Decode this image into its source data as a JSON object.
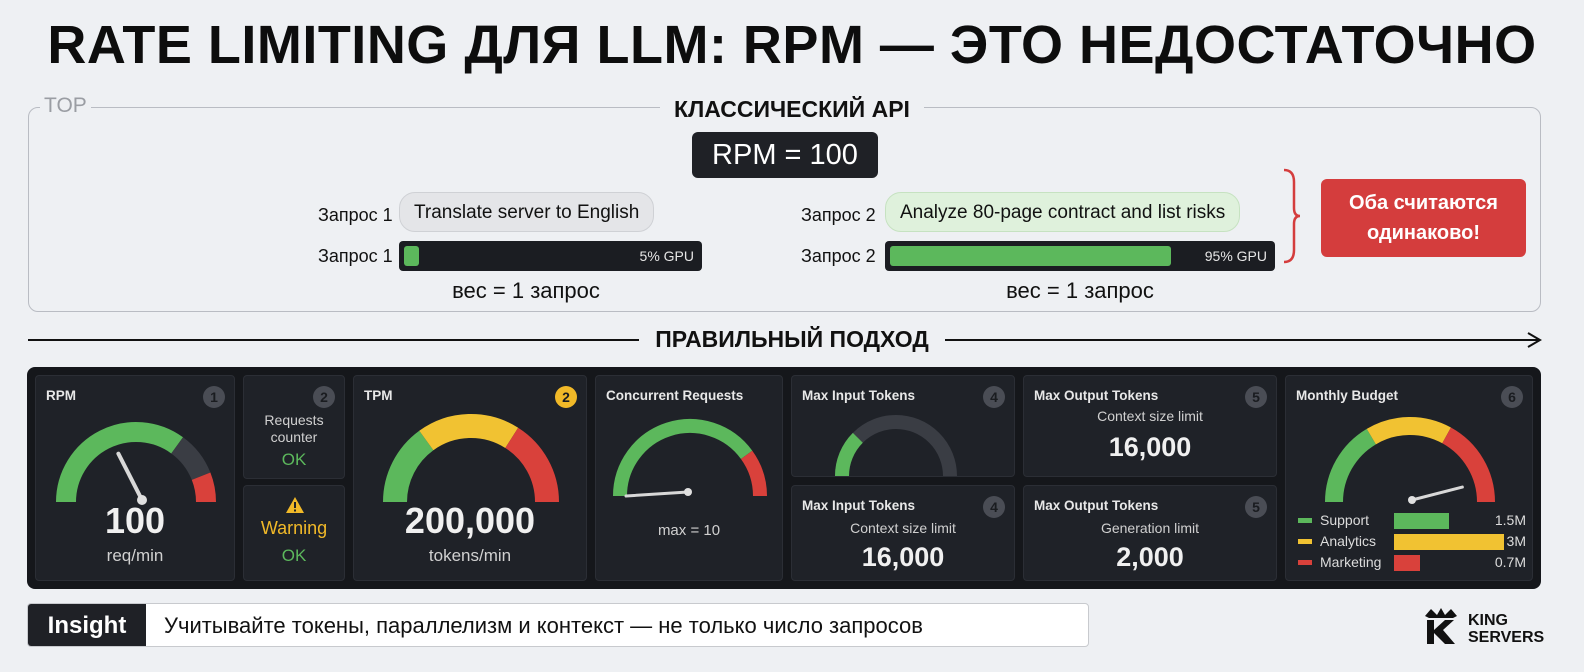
{
  "title": "RATE LIMITING ДЛЯ LLM: RPM — ЭТО НЕДОСТАТОЧНО",
  "top_section": {
    "tag": "TOP",
    "label": "КЛАССИЧЕСКИЙ API",
    "rpm_box": "RPM = 100",
    "request1": {
      "label": "Запрос 1",
      "prompt": "Translate server to English",
      "gpu_label": "5% GPU",
      "gpu_fraction": 0.05,
      "weight": "вес = 1 запрос"
    },
    "request2": {
      "label": "Запрос 2",
      "prompt": "Analyze 80-page contract and list risks",
      "gpu_label": "95% GPU",
      "gpu_fraction": 0.95,
      "weight": "вес = 1 запрос"
    },
    "conclusion": [
      "Оба считаются",
      "одинаково!"
    ]
  },
  "correct_label": "ПРАВИЛЬНЫЙ ПОДХОД",
  "dashboard": {
    "rpm": {
      "title": "RPM",
      "badge": "1",
      "value": "100",
      "unit": "req/min",
      "needle_fraction": 0.35
    },
    "requests_counter": {
      "badge": "2",
      "label": "Requests counter",
      "status": "OK"
    },
    "warning": {
      "icon": "warning-icon",
      "label": "Warning",
      "status": "OK"
    },
    "tpm": {
      "title": "TPM",
      "badge": "2",
      "value": "200,000",
      "unit": "tokens/min"
    },
    "concurrent": {
      "title": "Concurrent Requests",
      "value_label": "max = 10",
      "needle_fraction": 0.02
    },
    "max_input_gauge": {
      "title": "Max Input Tokens",
      "badge": "4",
      "fill_fraction": 0.25
    },
    "max_output_top": {
      "title": "Max Output Tokens",
      "badge": "5",
      "subtitle": "Context size limit",
      "value": "16,000"
    },
    "max_input_bottom": {
      "title": "Max Input Tokens",
      "badge": "4",
      "subtitle": "Context size limit",
      "value": "16,000"
    },
    "max_output_bottom": {
      "title": "Max Output Tokens",
      "badge": "5",
      "subtitle": "Generation limit",
      "value": "2,000"
    },
    "budget": {
      "title": "Monthly Budget",
      "badge": "6",
      "needle_fraction": 0.92,
      "legend": [
        {
          "name": "Support",
          "value": "1.5M",
          "amount": 1.5,
          "color": "#5cb85c"
        },
        {
          "name": "Analytics",
          "value": "3M",
          "amount": 3.0,
          "color": "#f1c232"
        },
        {
          "name": "Marketing",
          "value": "0.7M",
          "amount": 0.7,
          "color": "#d9413b"
        }
      ]
    }
  },
  "insight": {
    "tag": "Insight",
    "text": "Учитывайте токены, параллелизм и контекст — не только число запросов"
  },
  "logo": {
    "line1": "KING",
    "line2": "SERVERS"
  },
  "colors": {
    "green": "#5cb85c",
    "yellow": "#f1c232",
    "red": "#d9413b",
    "dark": "#1f2228"
  }
}
